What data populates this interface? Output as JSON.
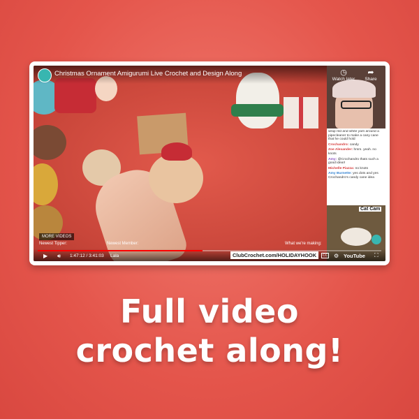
{
  "video": {
    "title": "Christmas Ornament Amigurumi Live Crochet and Design Along",
    "watch_later": "Watch later",
    "share": "Share",
    "more_videos": "MORE VIDEOS",
    "newest_tipper": "Newest Tipper:",
    "newest_member": "Newest Member:",
    "making": "What we're making:",
    "time": "1:47:12 / 3:41:03",
    "tipper_name": "Lala",
    "holiday_hook": "ClubCrochet.com/HOLIDAYHOOK",
    "cc": "CC",
    "youtube": "YouTube",
    "progress_fraction": 0.48,
    "cat_cam": "Cat Cam"
  },
  "chat": {
    "messages": [
      {
        "user": "",
        "text": "wrap red and white yarn around a pipecleaner to make a cany cane that he could hold"
      },
      {
        "user": "Crochandro:",
        "text": "candy"
      },
      {
        "user": "Zoe Alexander:",
        "text": "hmm. yeah. no knots"
      },
      {
        "user": "Amy:",
        "text": "@Crochandro thats such a good idea!!"
      },
      {
        "user": "Michelle Piazza:",
        "text": "no knots"
      },
      {
        "user": "Amy Burnette:",
        "text": "yes dots and yes Crochandro's candy cane idea"
      }
    ]
  },
  "caption": {
    "line1": "Full video",
    "line2": "crochet along!"
  },
  "colors": {
    "background": "#e4554b",
    "accent": "#38b6b0",
    "progress": "#ff0000"
  }
}
